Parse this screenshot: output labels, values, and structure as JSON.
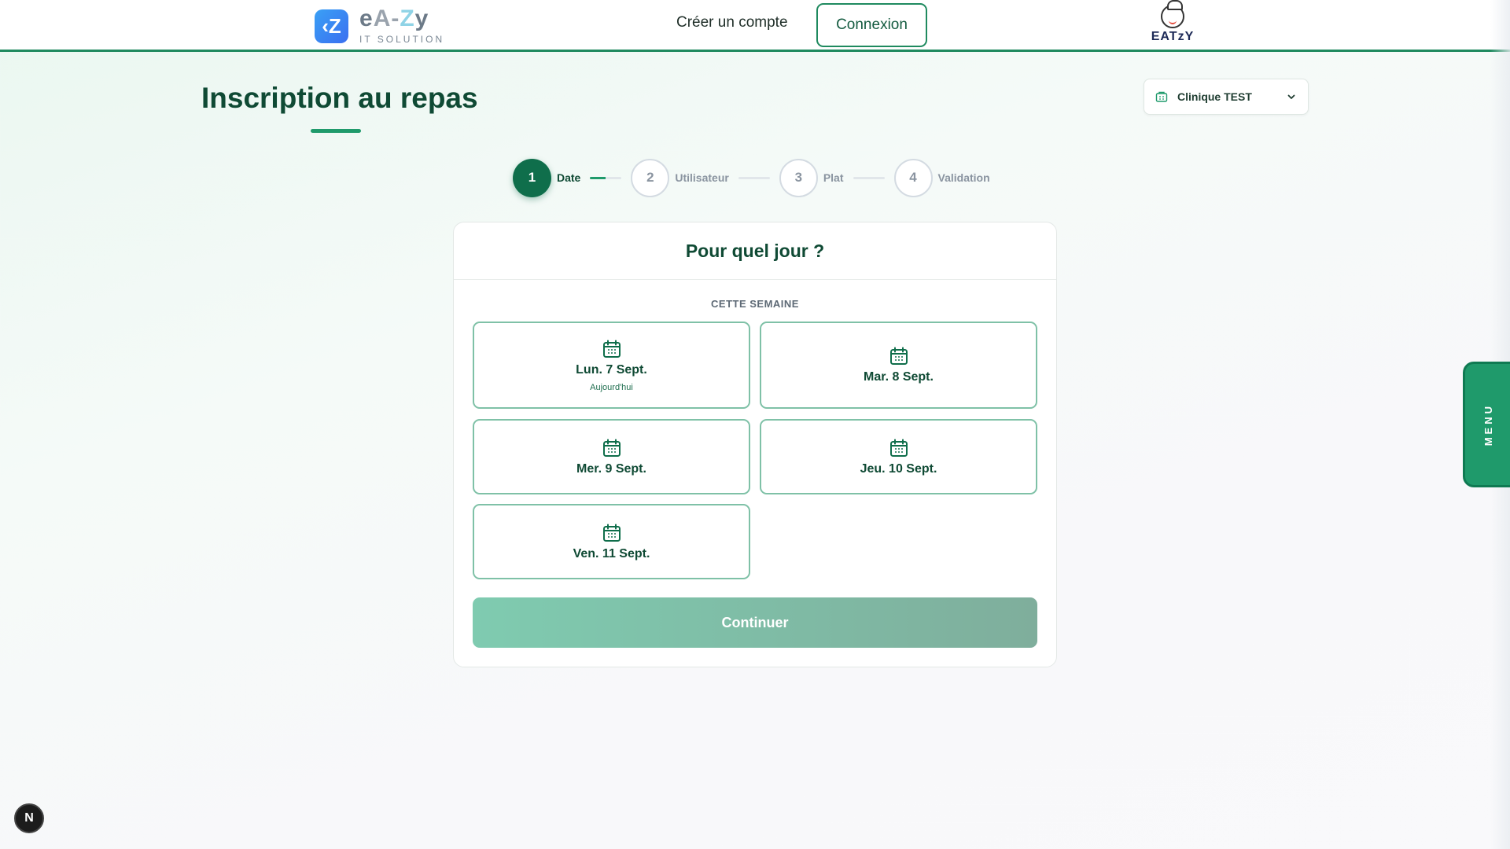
{
  "header": {
    "brand_name_parts": [
      "e",
      "A-",
      "Z",
      "y"
    ],
    "brand_subtitle": "IT SOLUTION",
    "create_account_label": "Créer un compte",
    "login_label": "Connexion",
    "partner_logo_text": "EATzY"
  },
  "page": {
    "title": "Inscription au repas"
  },
  "clinic_select": {
    "value": "Clinique TEST"
  },
  "stepper": {
    "steps": [
      {
        "number": "1",
        "label": "Date"
      },
      {
        "number": "2",
        "label": "Utilisateur"
      },
      {
        "number": "3",
        "label": "Plat"
      },
      {
        "number": "4",
        "label": "Validation"
      }
    ],
    "current_step": 1
  },
  "card": {
    "title": "Pour quel jour ?",
    "section_label": "CETTE SEMAINE",
    "days": [
      {
        "label": "Lun. 7 Sept.",
        "sub": "Aujourd'hui"
      },
      {
        "label": "Mar. 8 Sept.",
        "sub": ""
      },
      {
        "label": "Mer. 9 Sept.",
        "sub": ""
      },
      {
        "label": "Jeu. 10 Sept.",
        "sub": ""
      },
      {
        "label": "Ven. 11 Sept.",
        "sub": ""
      }
    ],
    "continue_label": "Continuer"
  },
  "side_menu": {
    "label": "MENU"
  },
  "dev_badge": {
    "label": "N"
  },
  "colors": {
    "primary": "#0f6e4b",
    "accent": "#1f9a6b",
    "day_border": "#7fc1a7"
  }
}
